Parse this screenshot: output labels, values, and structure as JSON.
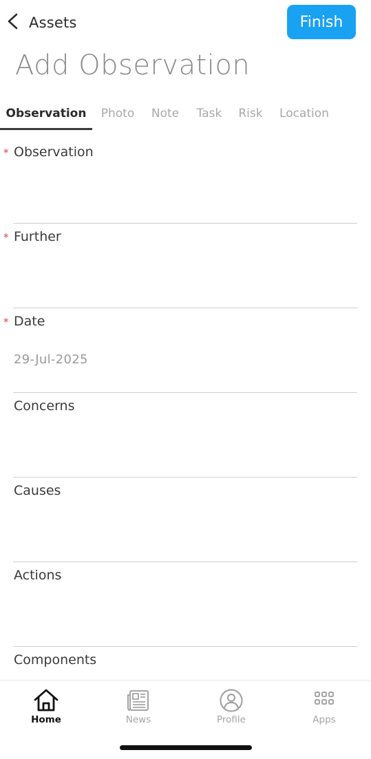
{
  "header": {
    "back_label": "Assets",
    "finish_label": "Finish"
  },
  "page": {
    "title": "Add Observation"
  },
  "tabs": [
    {
      "label": "Observation",
      "active": true
    },
    {
      "label": "Photo"
    },
    {
      "label": "Note"
    },
    {
      "label": "Task"
    },
    {
      "label": "Risk"
    },
    {
      "label": "Location"
    }
  ],
  "form": {
    "required_marker": "*",
    "fields": [
      {
        "label": "Observation",
        "required": true,
        "value": ""
      },
      {
        "label": "Further",
        "required": true,
        "value": ""
      },
      {
        "label": "Date",
        "required": true,
        "value": "29-Jul-2025"
      },
      {
        "label": "Concerns",
        "required": false,
        "value": ""
      },
      {
        "label": "Causes",
        "required": false,
        "value": ""
      },
      {
        "label": "Actions",
        "required": false,
        "value": ""
      },
      {
        "label": "Components",
        "required": false,
        "value": ""
      }
    ]
  },
  "bottom_nav": [
    {
      "label": "Home",
      "icon": "home-icon",
      "active": true
    },
    {
      "label": "News",
      "icon": "news-icon"
    },
    {
      "label": "Profile",
      "icon": "profile-icon"
    },
    {
      "label": "Apps",
      "icon": "apps-icon"
    }
  ],
  "colors": {
    "accent": "#1aa2f2",
    "required": "#e04040",
    "inactive": "#a8a8a8"
  }
}
